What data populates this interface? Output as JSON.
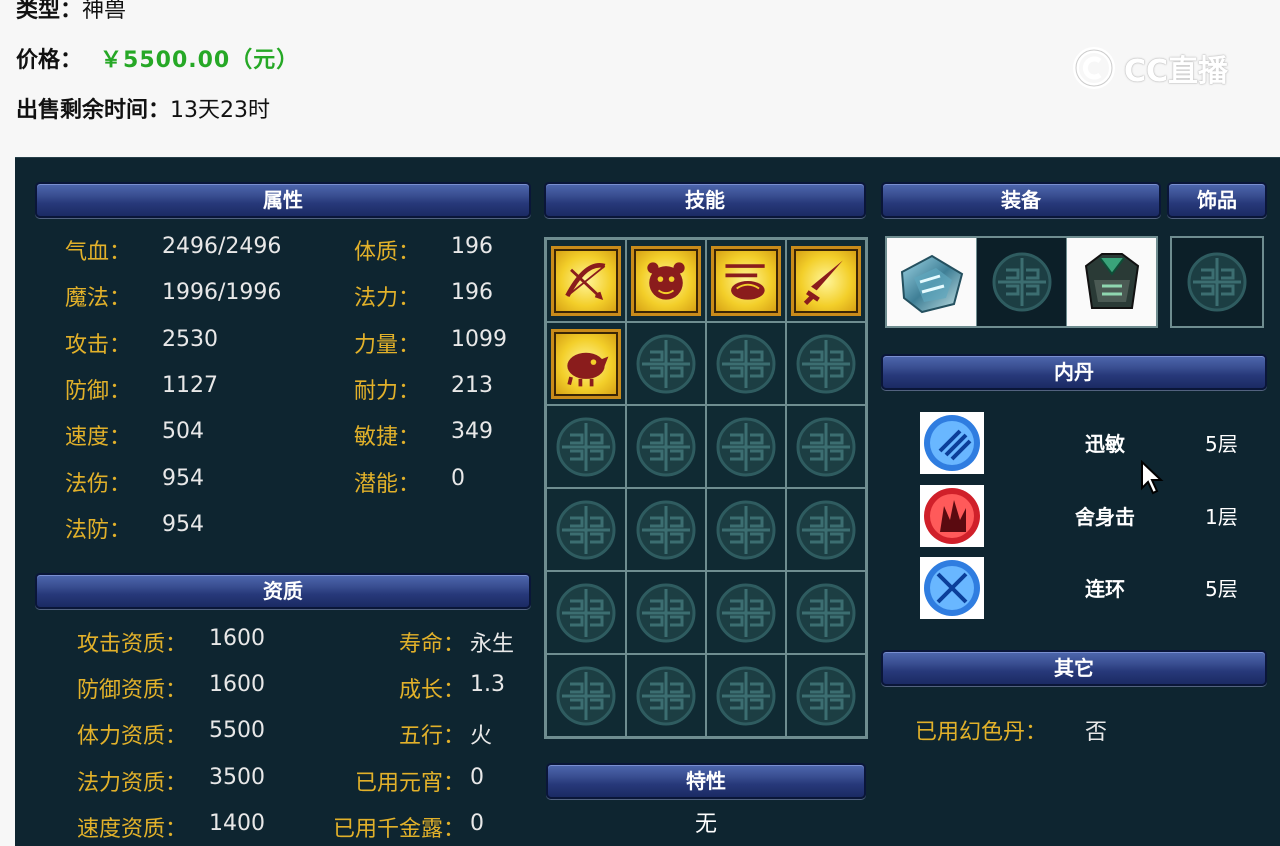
{
  "top": {
    "type_label": "类型：",
    "type_value": "神兽",
    "price_label": "价格：",
    "price_value": "￥5500.00（元）",
    "time_label": "出售剩余时间：",
    "time_value": "13天23时"
  },
  "watermark": {
    "text": "CC直播"
  },
  "sections": {
    "attributes": "属性",
    "skills": "技能",
    "equipment": "装备",
    "accessory": "饰品",
    "inner_dan": "内丹",
    "aptitude": "资质",
    "trait": "特性",
    "other": "其它"
  },
  "attributes": {
    "left": [
      {
        "label": "气血：",
        "value": "2496/2496"
      },
      {
        "label": "魔法：",
        "value": "1996/1996"
      },
      {
        "label": "攻击：",
        "value": "2530"
      },
      {
        "label": "防御：",
        "value": "1127"
      },
      {
        "label": "速度：",
        "value": "504"
      },
      {
        "label": "法伤：",
        "value": "954"
      },
      {
        "label": "法防：",
        "value": "954"
      }
    ],
    "right": [
      {
        "label": "体质：",
        "value": "196"
      },
      {
        "label": "法力：",
        "value": "196"
      },
      {
        "label": "力量：",
        "value": "1099"
      },
      {
        "label": "耐力：",
        "value": "213"
      },
      {
        "label": "敏捷：",
        "value": "349"
      },
      {
        "label": "潜能：",
        "value": "0"
      }
    ]
  },
  "aptitude": {
    "left": [
      {
        "label": "攻击资质：",
        "value": "1600"
      },
      {
        "label": "防御资质：",
        "value": "1600"
      },
      {
        "label": "体力资质：",
        "value": "5500"
      },
      {
        "label": "法力资质：",
        "value": "3500"
      },
      {
        "label": "速度资质：",
        "value": "1400"
      }
    ],
    "right": [
      {
        "label": "寿命：",
        "value": "永生"
      },
      {
        "label": "成长：",
        "value": "1.3"
      },
      {
        "label": "五行：",
        "value": "火"
      },
      {
        "label": "已用元宵：",
        "value": "0"
      },
      {
        "label": "已用千金露：",
        "value": "0"
      }
    ]
  },
  "skills": {
    "icons": [
      "bow-skill-icon",
      "beast-skill-icon",
      "fire-skill-icon",
      "sword-skill-icon",
      "boar-skill-icon"
    ],
    "total_slots": 24
  },
  "trait": {
    "value": "无"
  },
  "inner_dan": [
    {
      "name": "迅敏",
      "level": "5层",
      "icon": "claw-dan-icon",
      "color": "#2f7de0"
    },
    {
      "name": "舍身击",
      "level": "1层",
      "icon": "flame-dan-icon",
      "color": "#d0202a"
    },
    {
      "name": "连环",
      "level": "5层",
      "icon": "slash-dan-icon",
      "color": "#2f7de0"
    }
  ],
  "other": {
    "label": "已用幻色丹：",
    "value": "否"
  },
  "colors": {
    "panel_bg": "#0e2530",
    "label_gold": "#e2b12a",
    "price_green": "#26a826",
    "header_blue": "#2b3f84"
  }
}
